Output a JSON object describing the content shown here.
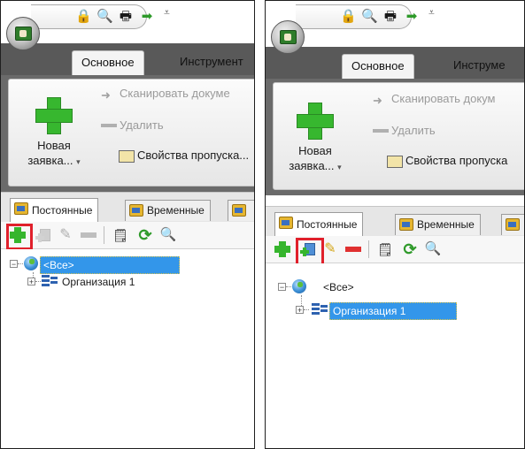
{
  "ribbon_tabs": [
    "Основное",
    "Инструменты",
    "Инструменты"
  ],
  "ribbon_tabs_visible": {
    "left": "Инструмент",
    "right": "Инструме"
  },
  "ribbon": {
    "new_request_line1": "Новая",
    "new_request_line2": "заявка...",
    "scan_document": {
      "left": "Сканировать докуме",
      "right": "Сканировать докум"
    },
    "delete": "Удалить",
    "pass_properties": {
      "left": "Свойства пропуска...",
      "right": "Свойства пропуска"
    }
  },
  "subtabs": {
    "permanent": "Постоянные",
    "temporary": "Временные"
  },
  "tree": {
    "root": "<Все>",
    "org": "Организация 1"
  },
  "colors": {
    "highlight": "#e0202b",
    "selection": "#3396ea",
    "accent_green": "#36b52d",
    "delete_red": "#e03030"
  },
  "icons": [
    "app-menu-icon",
    "lock-icon",
    "search-icon",
    "print-icon",
    "export-icon",
    "add-icon",
    "add-subitem-icon",
    "edit-icon",
    "delete-icon",
    "checklist-icon",
    "refresh-icon",
    "find-icon",
    "globe-icon",
    "organization-icon"
  ]
}
